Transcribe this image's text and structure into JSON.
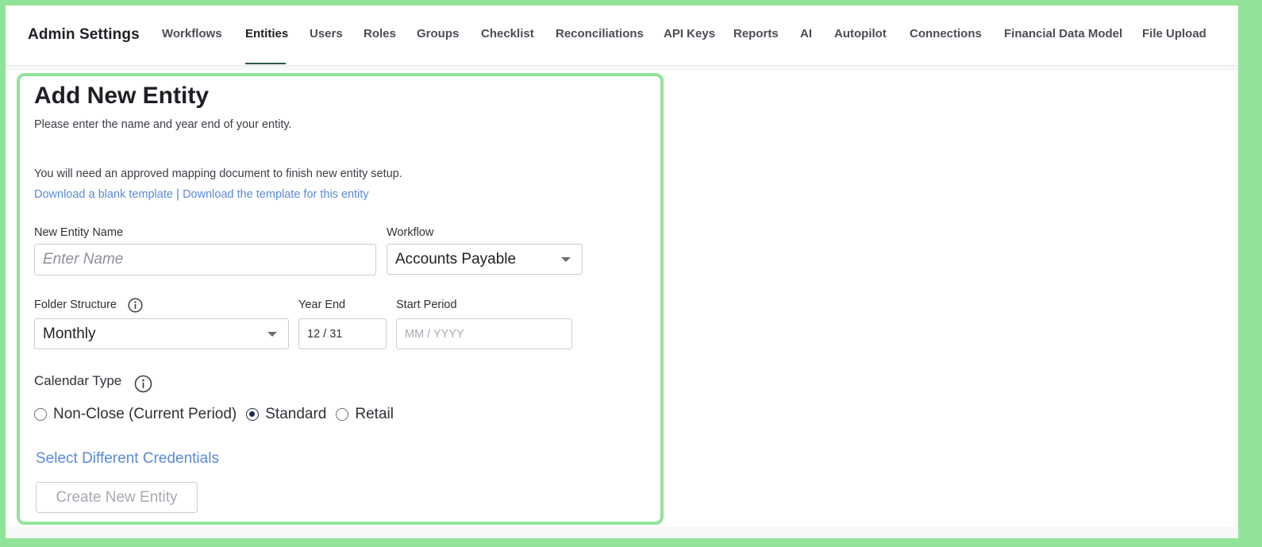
{
  "header": {
    "title": "Admin Settings",
    "tabs": [
      {
        "label": "Workflows"
      },
      {
        "label": "Entities",
        "active": true
      },
      {
        "label": "Users"
      },
      {
        "label": "Roles"
      },
      {
        "label": "Groups"
      },
      {
        "label": "Checklist"
      },
      {
        "label": "Reconciliations"
      },
      {
        "label": "API Keys"
      },
      {
        "label": "Reports"
      },
      {
        "label": "AI"
      },
      {
        "label": "Autopilot"
      },
      {
        "label": "Connections"
      },
      {
        "label": "Financial Data Model"
      },
      {
        "label": "File Upload"
      }
    ]
  },
  "form": {
    "title": "Add New Entity",
    "subtitle": "Please enter the name and year end of your entity.",
    "mapping_note": "You will need an approved mapping document to finish new entity setup.",
    "link_blank_template": "Download a blank template",
    "link_separator": "|",
    "link_entity_template": "Download the template for this entity",
    "entity_name": {
      "label": "New Entity Name",
      "value": "",
      "placeholder": "Enter Name"
    },
    "workflow": {
      "label": "Workflow",
      "value": "Accounts Payable"
    },
    "folder_structure": {
      "label": "Folder Structure",
      "value": "Monthly"
    },
    "year_end": {
      "label": "Year End",
      "value": "12 / 31"
    },
    "start_period": {
      "label": "Start Period",
      "value": "",
      "placeholder": "MM / YYYY"
    },
    "calendar_type": {
      "label": "Calendar Type",
      "options": [
        {
          "label": "Non-Close (Current Period)",
          "selected": false
        },
        {
          "label": "Standard",
          "selected": true
        },
        {
          "label": "Retail",
          "selected": false
        }
      ]
    },
    "credentials_link": "Select Different Credentials",
    "create_button": "Create New Entity"
  },
  "colors": {
    "accent_underline": "#2b5a49",
    "link": "#5a8ad6",
    "highlight_border": "#92e39a"
  },
  "icons": {
    "info": "info-circle-icon",
    "dropdown": "chevron-down-icon"
  }
}
